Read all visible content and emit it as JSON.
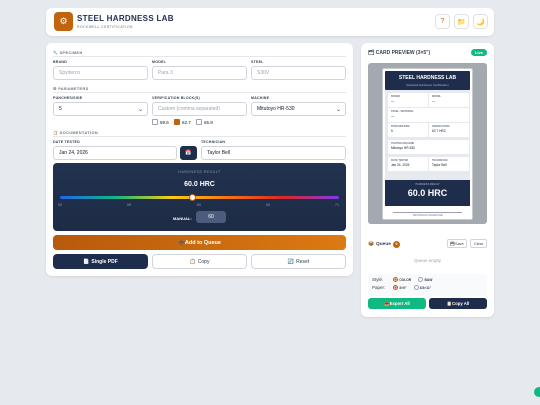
{
  "header": {
    "title": "STEEL HARDNESS LAB",
    "subtitle": "ROCKWELL CERTIFICATION",
    "help_icon": "?",
    "folder_icon": "📁",
    "theme_icon": "🌙"
  },
  "specimen": {
    "section": "SPECIMEN",
    "brand_label": "BRAND",
    "brand_placeholder": "Spyderco",
    "model_label": "MODEL",
    "model_placeholder": "Para 3",
    "steel_label": "STEEL",
    "steel_placeholder": "S30V"
  },
  "parameters": {
    "section": "PARAMETERS",
    "punches_label": "PUNCHES/SIDE",
    "punches_value": "5",
    "verif_label": "VERIFICATION BLOCK(S)",
    "verif_placeholder": "Custom (comma separated)",
    "machine_label": "MACHINE",
    "machine_value": "Mitutoyo HR-530",
    "blocks": [
      {
        "label": "59.6",
        "checked": false
      },
      {
        "label": "62.7",
        "checked": true
      },
      {
        "label": "65.9",
        "checked": false
      }
    ]
  },
  "documentation": {
    "section": "DOCUMENTATION",
    "date_label": "DATE TESTED",
    "date_value": "Jan 24, 2026",
    "tech_label": "TECHNICIAN",
    "tech_value": "Taylor Bell"
  },
  "gauge": {
    "label": "HARDNESS RESULT",
    "value_text": "60.0 HRC",
    "value": 60,
    "min": 50,
    "max": 71,
    "ticks": [
      "50",
      "55",
      "60",
      "65",
      "71"
    ],
    "manual_label": "MANUAL:",
    "manual_value": "60"
  },
  "actions": {
    "add": "Add to Queue",
    "pdf": "Single PDF",
    "copy": "Copy",
    "reset": "Reset"
  },
  "preview": {
    "title": "CARD PREVIEW (3×5\")",
    "live": "Live",
    "card_title": "STEEL HARDNESS LAB",
    "card_sub": "Rockwell Hardness Certification",
    "f_brand": "BRAND",
    "f_brand_v": "—",
    "f_model": "MODEL",
    "f_model_v": "—",
    "f_steel": "STEEL / MATERIAL",
    "f_steel_v": "—",
    "f_punches": "PUNCHES/SIDE",
    "f_punches_v": "5",
    "f_verif": "VERIFICATION",
    "f_verif_v": "62.7 HRC",
    "f_machine": "TESTING MACHINE",
    "f_machine_v": "Mitutoyo HR-530",
    "f_date": "DATE TESTED",
    "f_date_v": "Jan 24, 2026",
    "f_tech": "TECHNICIAN",
    "f_tech_v": "Taylor Bell",
    "result_label": "HARDNESS RESULT",
    "result_value": "60.0 HRC",
    "signature": "TECHNICIAN SIGNATURE"
  },
  "queue": {
    "title": "Queue",
    "count": "0",
    "save": "Save",
    "clear": "Clear",
    "empty": "Queue empty",
    "style_label": "Style:",
    "style_color": "COLOR",
    "style_bw": "B&W",
    "paper_label": "Paper:",
    "paper_3x5": "3×5\"",
    "paper_85x11": "8.5×11\"",
    "export_all": "Export All",
    "copy_all": "Copy All"
  },
  "colors": {
    "accent": "#c2630e",
    "navy": "#1f2d4d",
    "green": "#10b981"
  }
}
